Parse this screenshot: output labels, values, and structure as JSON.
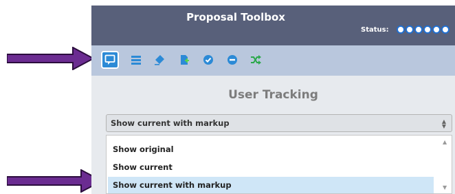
{
  "toolbox": {
    "title": "Proposal Toolbox",
    "status_label": "Status:",
    "status_dot_count": 6,
    "accent_color": "#2c8ad6",
    "toolbar_icons": [
      "comment-icon",
      "list-icon",
      "eraser-icon",
      "add-document-icon",
      "check-icon",
      "minus-circle-icon",
      "shuffle-icon"
    ]
  },
  "tracking": {
    "title": "User Tracking",
    "selected": "Show current with markup",
    "options": [
      "Show original",
      "Show current",
      "Show current with markup"
    ]
  },
  "annotation": {
    "arrow_color": "#6b2c91"
  }
}
